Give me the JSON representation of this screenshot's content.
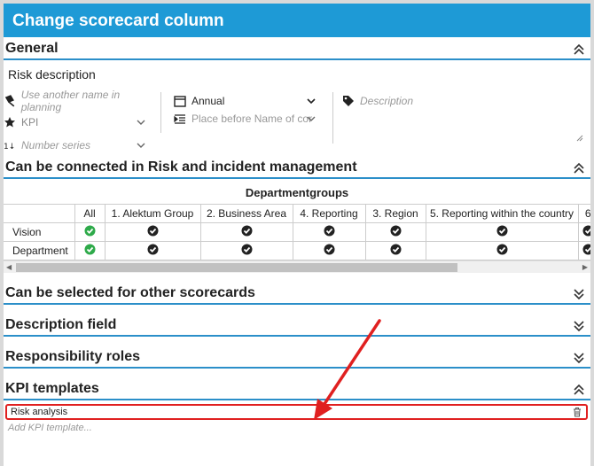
{
  "dialog": {
    "title": "Change scorecard column"
  },
  "general": {
    "heading": "General",
    "name_value": "Risk description",
    "alt_name_placeholder": "Use another name in planning",
    "kpi_value": "KPI",
    "number_series_placeholder": "Number series",
    "period_value": "Annual",
    "place_before_placeholder": "Place before Name of cor",
    "description_placeholder": "Description"
  },
  "risk_section": {
    "heading": "Can be connected in Risk and incident management",
    "table_title": "Departmentgroups",
    "columns": [
      "All",
      "1. Alektum Group",
      "2. Business Area",
      "4. Reporting",
      "3. Region",
      "5. Reporting within the country",
      "6"
    ],
    "rows": [
      {
        "label": "Vision"
      },
      {
        "label": "Department"
      }
    ]
  },
  "other_sections": {
    "selected": "Can be selected for other scorecards",
    "description_field": "Description field",
    "responsibility": "Responsibility roles",
    "kpi_templates": "KPI templates"
  },
  "kpi_templates": {
    "items": [
      "Risk analysis"
    ],
    "add_placeholder": "Add KPI template..."
  },
  "colors": {
    "accent": "#1e9ad6",
    "highlight": "#e02020",
    "check_all": "#2eaa4a",
    "check": "#222222"
  }
}
